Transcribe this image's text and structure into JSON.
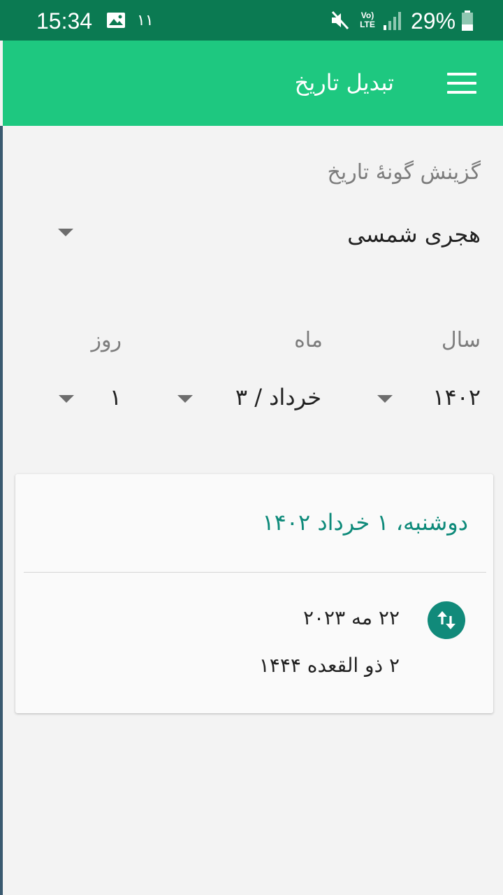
{
  "status_bar": {
    "time": "15:34",
    "notification_count": "۱۱",
    "network_label_top": "Vo)",
    "network_label_bottom": "LTE",
    "battery": "29%",
    "icons": [
      "gallery-icon",
      "mute-icon",
      "signal-icon",
      "battery-icon"
    ]
  },
  "app_bar": {
    "title": "تبدیل تاریخ",
    "menu_icon": "hamburger-menu-icon",
    "color": "#1ec880"
  },
  "form": {
    "type_label": "گزینش گونهٔ تاریخ",
    "type_value": "هجری شمسی",
    "year_label": "سال",
    "month_label": "ماه",
    "day_label": "روز",
    "year_value": "۱۴۰۲",
    "month_value": "خرداد / ۳",
    "day_value": "۱"
  },
  "result": {
    "heading": "دوشنبه، ۱ خرداد ۱۴۰۲",
    "gregorian": "۲۲ مه ۲۰۲۳",
    "hijri": "۲ ذو القعده ۱۴۴۴",
    "swap_icon": "swap-vertical-icon",
    "accent": "#0e8a7a"
  }
}
